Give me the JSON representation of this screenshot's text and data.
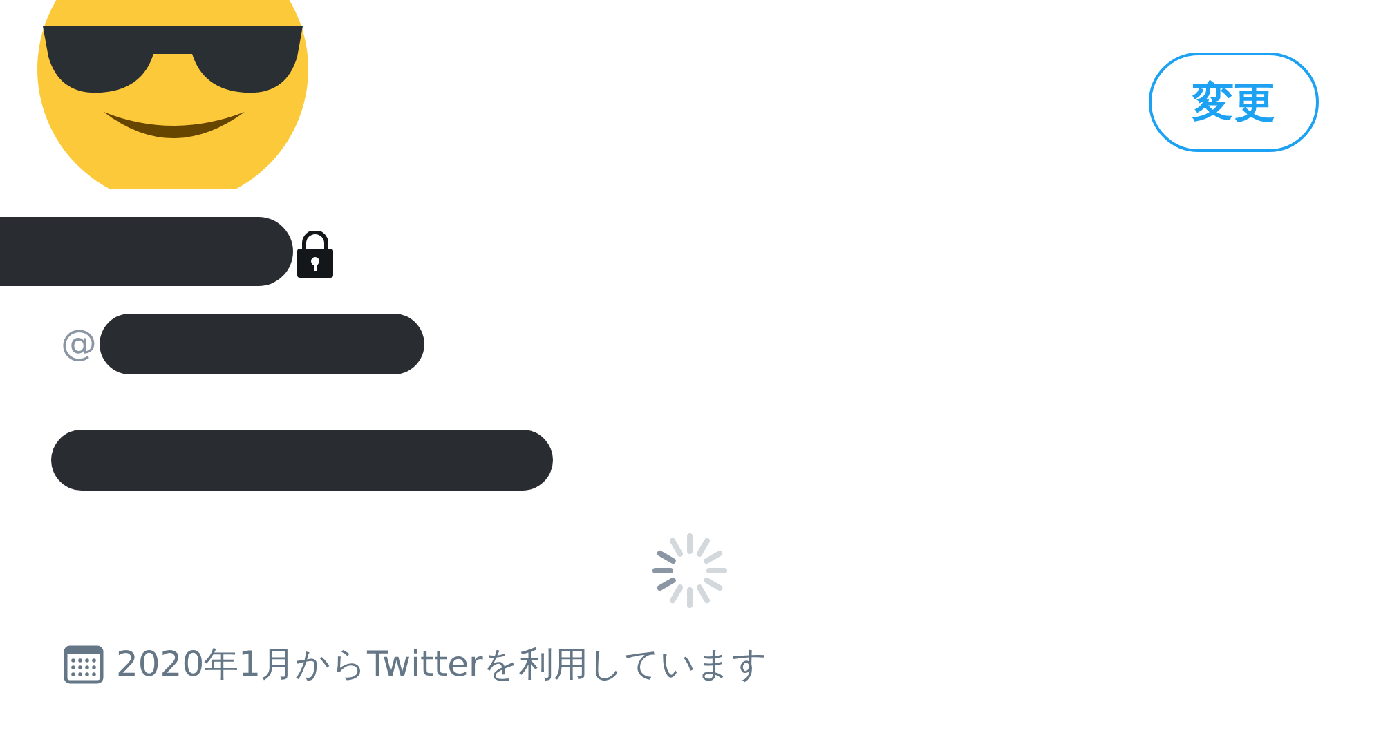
{
  "profile": {
    "edit_button": {
      "label": "変更"
    },
    "protected": true,
    "handle_prefix": "@",
    "loading": true,
    "joined": "2020年1月からTwitterを利用しています"
  }
}
